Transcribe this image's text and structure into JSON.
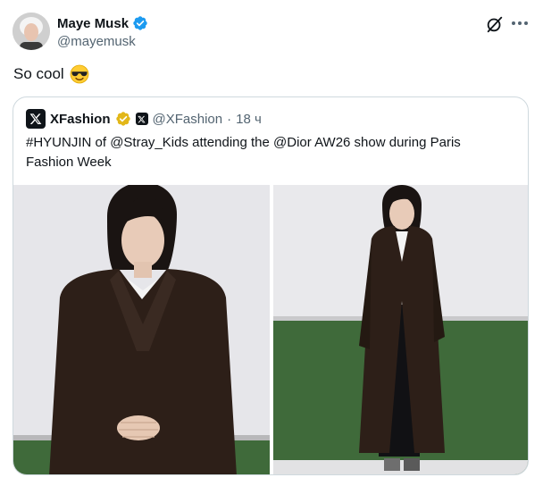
{
  "author": {
    "display_name": "Maye Musk",
    "handle": "@mayemusk",
    "verified": true,
    "verified_color": "#1d9bf0"
  },
  "tweet": {
    "text": "So cool",
    "emoji": "smiling-face-with-sunglasses"
  },
  "quoted": {
    "display_name": "XFashion",
    "badge": "gold-verified",
    "affiliate_badge": "x-logo",
    "handle": "@XFashion",
    "separator": "·",
    "time": "18 ч",
    "text": "#HYUNJIN of @Stray_Kids attending the @Dior AW26 show during Paris Fashion Week",
    "badge_color": "#e2b719"
  },
  "icons": {
    "grok": "grok-icon",
    "more": "more-options-icon"
  },
  "colors": {
    "text_primary": "#0f1419",
    "text_secondary": "#536471",
    "border": "#cfd9de",
    "coat": "#2d1f18",
    "wall": "#e9e9ec",
    "wainscot": "#3f6a3a"
  }
}
